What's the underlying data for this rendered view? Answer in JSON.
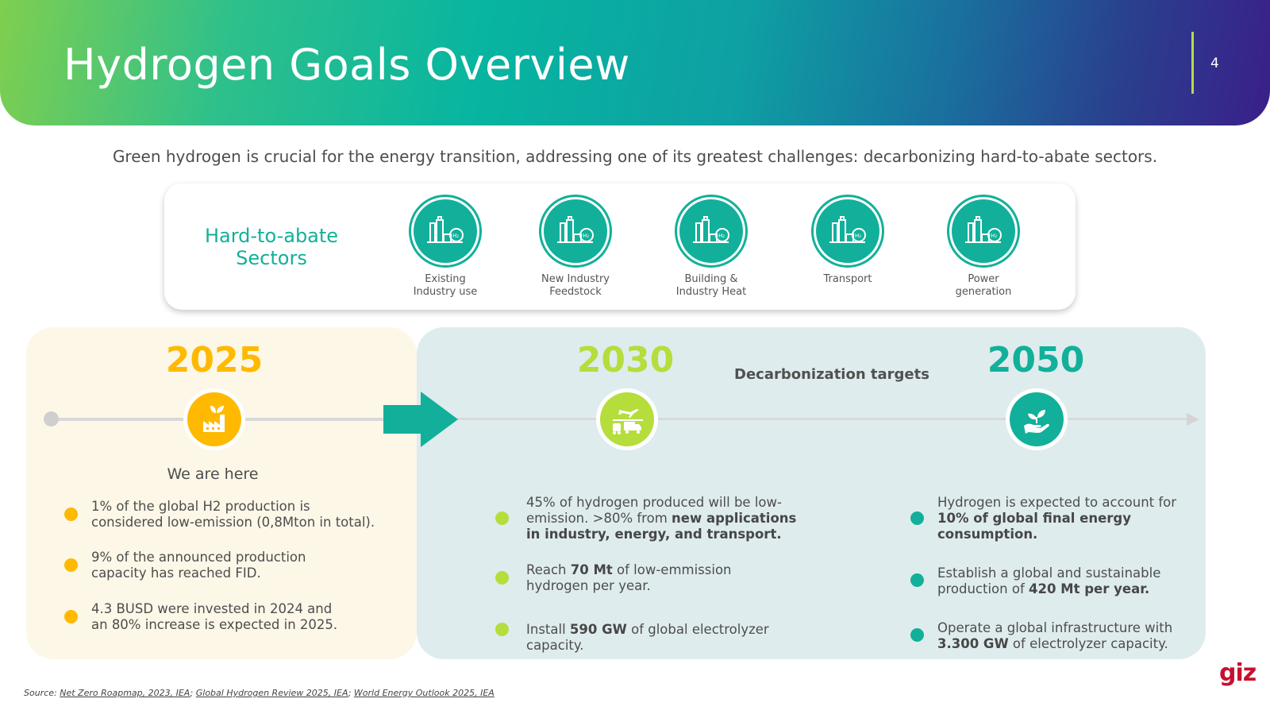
{
  "header": {
    "title": "Hydrogen Goals Overview",
    "page_number": "4"
  },
  "subtitle": "Green hydrogen is crucial for the energy transition, addressing one of its greatest challenges: decarbonizing hard-to-abate sectors.",
  "sectors": {
    "title_line1": "Hard-to-abate",
    "title_line2": "Sectors",
    "items": [
      {
        "line1": "Existing",
        "line2": "Industry use",
        "icon": "industry-h2-icon"
      },
      {
        "line1": "New Industry",
        "line2": "Feedstock",
        "icon": "industry-h2-icon"
      },
      {
        "line1": "Building &",
        "line2": "Industry Heat",
        "icon": "industry-h2-icon"
      },
      {
        "line1": "Transport",
        "line2": "",
        "icon": "industry-h2-icon"
      },
      {
        "line1": "Power",
        "line2": "generation",
        "icon": "industry-h2-icon"
      }
    ]
  },
  "timeline": {
    "decarbonization_label": "Decarbonization targets",
    "y2025": {
      "year": "2025",
      "color": "#ffb900",
      "status": "We are here",
      "icon": "factory-leaf-icon",
      "bullets": [
        {
          "parts": [
            "1% of the global H2 production is considered low-emission (0,8Mton in total)."
          ]
        },
        {
          "parts": [
            "9% of the announced production capacity has reached FID."
          ]
        },
        {
          "parts": [
            "4.3 BUSD were invested in 2024 and an 80% increase is expected in 2025."
          ]
        }
      ]
    },
    "y2030": {
      "year": "2030",
      "color": "#b5dd3c",
      "icon": "transport-modes-icon",
      "bullets": [
        {
          "pre": "45% of hydrogen produced will be low-emission. >80% from ",
          "bold": "new applications in industry, energy, and transport.",
          "post": ""
        },
        {
          "pre": "Reach ",
          "bold": "70 Mt",
          "post": " of low-emmission hydrogen per year."
        },
        {
          "pre": "Install ",
          "bold": "590 GW",
          "post": " of global electrolyzer capacity."
        }
      ]
    },
    "y2050": {
      "year": "2050",
      "color": "#12b09a",
      "icon": "hand-plant-icon",
      "bullets": [
        {
          "pre": "Hydrogen is expected to account for ",
          "bold": "10% of global final energy consumption.",
          "post": ""
        },
        {
          "pre": "Establish a global and sustainable production of ",
          "bold": "420 Mt per year.",
          "post": ""
        },
        {
          "pre": "Operate a global infrastructure with ",
          "bold": "3.300 GW",
          "post": " of electrolyzer capacity."
        }
      ]
    }
  },
  "footer": {
    "logo": "giz",
    "source_prefix": "Source: ",
    "source_1": "Net Zero Roapmap, 2023, IEA",
    "source_sep1": "; ",
    "source_2": "Global Hydrogen Review 2025, IEA",
    "source_sep2": "; ",
    "source_3": "World Energy Outlook 2025, IEA"
  },
  "colors": {
    "teal": "#12b09a",
    "yellow": "#ffb900",
    "lime": "#b5dd3c",
    "panel_2025_bg": "#fdf7e8",
    "panel_targets_bg": "#dfecee"
  }
}
